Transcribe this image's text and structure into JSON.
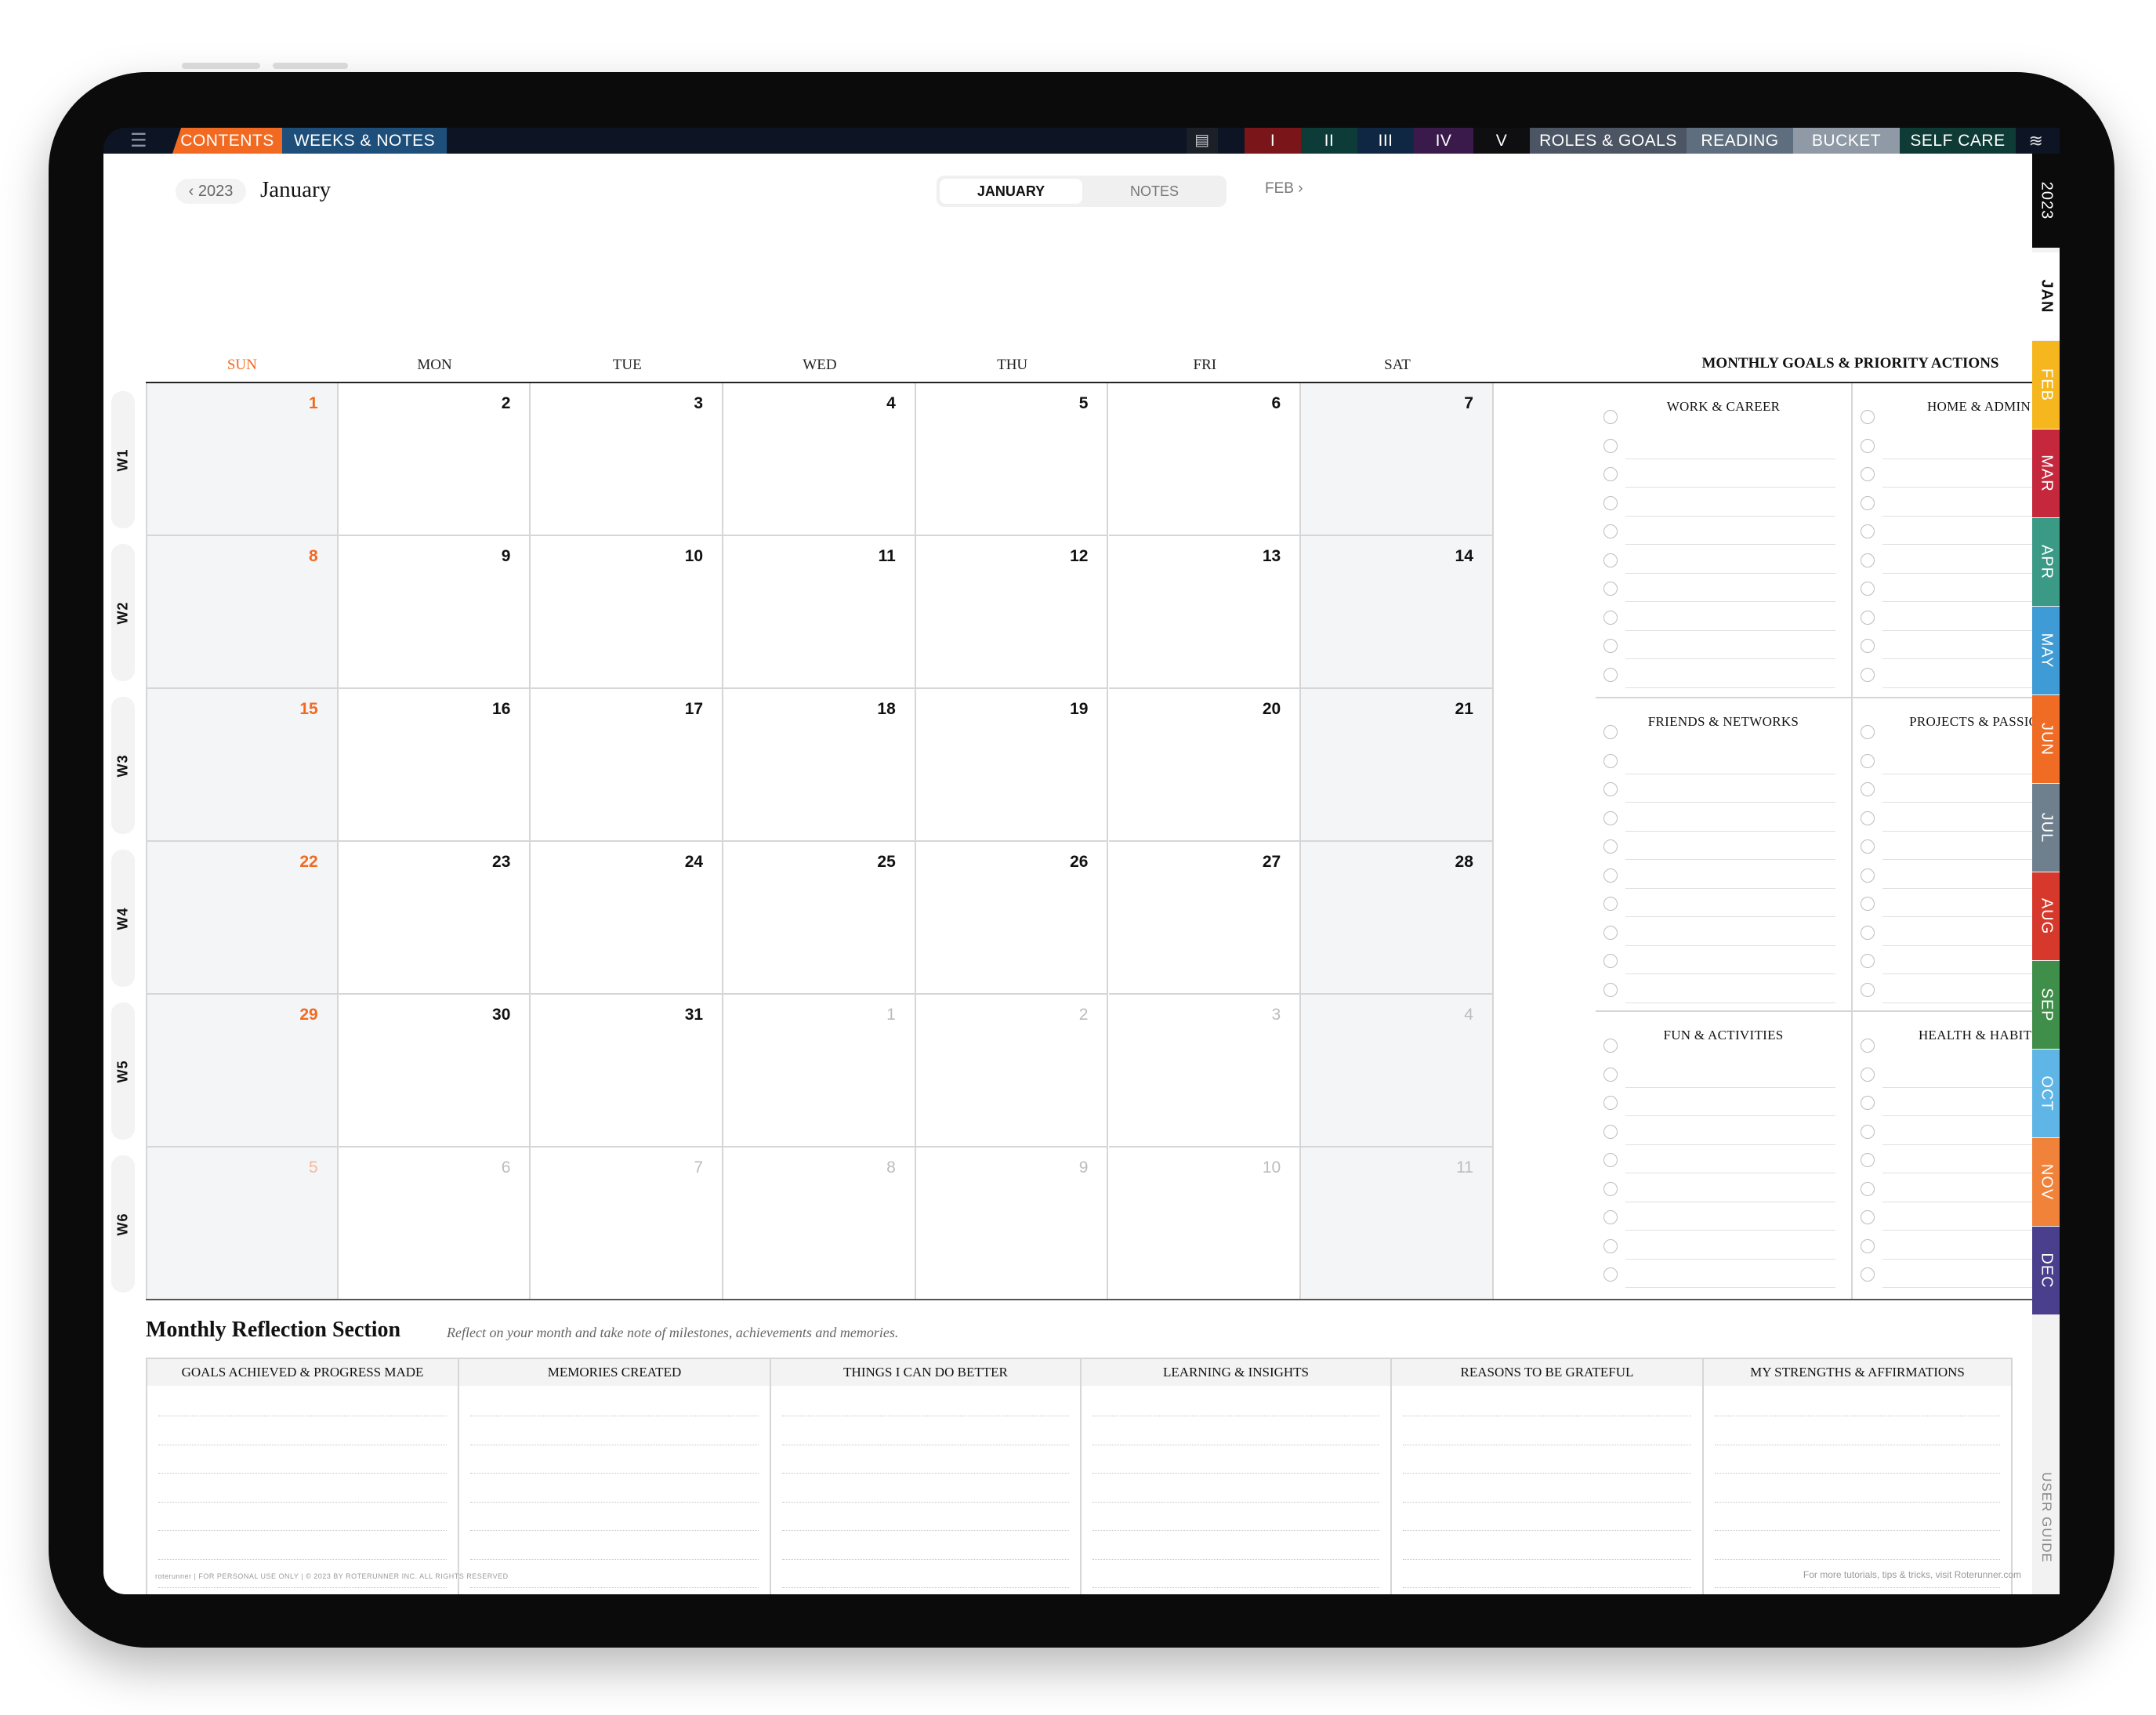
{
  "topbar": {
    "contents": "CONTENTS",
    "weeks_notes": "WEEKS & NOTES",
    "quarters": [
      "I",
      "II",
      "III",
      "IV",
      "V"
    ],
    "tabs": [
      "ROLES & GOALS",
      "READING",
      "BUCKET",
      "SELF CARE"
    ]
  },
  "header": {
    "year_back": "2023",
    "month_title": "January",
    "seg_month": "JANUARY",
    "seg_notes": "NOTES",
    "next_month": "FEB"
  },
  "days": [
    "SUN",
    "MON",
    "TUE",
    "WED",
    "THU",
    "FRI",
    "SAT"
  ],
  "weeks": [
    "W1",
    "W2",
    "W3",
    "W4",
    "W5",
    "W6"
  ],
  "calendar": [
    [
      "1",
      "2",
      "3",
      "4",
      "5",
      "6",
      "7"
    ],
    [
      "8",
      "9",
      "10",
      "11",
      "12",
      "13",
      "14"
    ],
    [
      "15",
      "16",
      "17",
      "18",
      "19",
      "20",
      "21"
    ],
    [
      "22",
      "23",
      "24",
      "25",
      "26",
      "27",
      "28"
    ],
    [
      "29",
      "30",
      "31",
      "1",
      "2",
      "3",
      "4"
    ],
    [
      "5",
      "6",
      "7",
      "8",
      "9",
      "10",
      "11"
    ]
  ],
  "goals": {
    "title": "MONTHLY GOALS & PRIORITY ACTIONS",
    "sections": [
      "WORK & CAREER",
      "HOME & ADMIN",
      "FRIENDS & NETWORKS",
      "PROJECTS & PASSION",
      "FUN & ACTIVITIES",
      "HEALTH & HABITS"
    ]
  },
  "reflection": {
    "title": "Monthly Reflection Section",
    "subtitle": "Reflect on your month and take note of milestones, achievements and memories.",
    "columns": [
      "GOALS ACHIEVED & PROGRESS MADE",
      "MEMORIES CREATED",
      "THINGS I CAN DO BETTER",
      "LEARNING & INSIGHTS",
      "REASONS TO BE GRATEFUL",
      "MY STRENGTHS & AFFIRMATIONS"
    ]
  },
  "side_tabs": {
    "year": "2023",
    "months": [
      "JAN",
      "FEB",
      "MAR",
      "APR",
      "MAY",
      "JUN",
      "JUL",
      "AUG",
      "SEP",
      "OCT",
      "NOV",
      "DEC"
    ],
    "user_guide": "USER GUIDE"
  },
  "footer": {
    "left": "roterunner | FOR PERSONAL USE ONLY | © 2023 BY ROTERUNNER INC. ALL RIGHTS RESERVED",
    "right": "For more tutorials, tips & tricks, visit Roterunner.com"
  },
  "colors": {
    "accent": "#f26a21",
    "navy": "#1d4f7a",
    "months": [
      "#ffffff",
      "#f6b61d",
      "#c5283d",
      "#3b9a86",
      "#3e9bd5",
      "#f06b24",
      "#6e7f8e",
      "#d6392b",
      "#3f8f4a",
      "#5fb6e6",
      "#f1823a",
      "#4a3f8c"
    ]
  }
}
